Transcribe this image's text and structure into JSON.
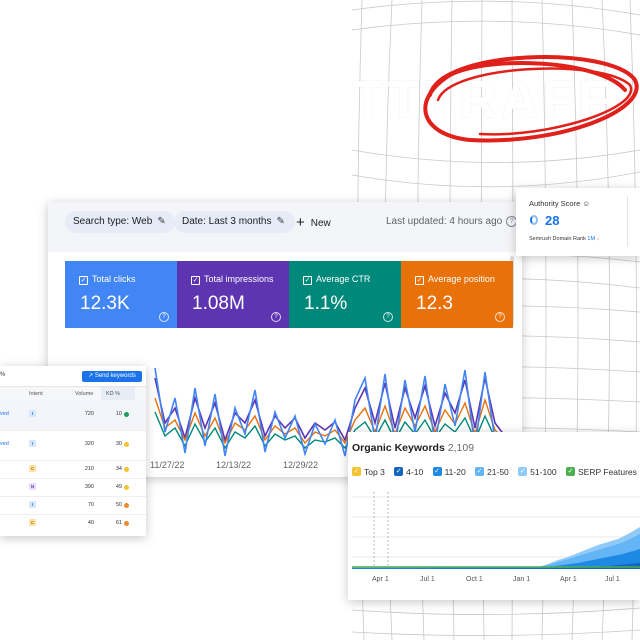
{
  "background": {
    "hero_word": "TTTRAFFIC"
  },
  "search_console": {
    "filters": {
      "search_type": "Search type: Web",
      "date": "Date: Last 3 months",
      "new_label": "New"
    },
    "last_updated": "Last updated: 4 hours ago",
    "metrics": [
      {
        "label": "Total clicks",
        "value": "12.3K",
        "color": "#4285f4"
      },
      {
        "label": "Total impressions",
        "value": "1.08M",
        "color": "#5e35b1"
      },
      {
        "label": "Average CTR",
        "value": "1.1%",
        "color": "#00897b"
      },
      {
        "label": "Average position",
        "value": "12.3",
        "color": "#e8710a"
      }
    ],
    "x_labels": [
      "11/27/22",
      "12/13/22",
      "12/29/22"
    ]
  },
  "keyword_table": {
    "percent_text": "%",
    "send_button": "Send keywords",
    "columns": {
      "intent": "Intent",
      "volume": "Volume",
      "kd": "KD %"
    },
    "rows": [
      {
        "keyword": "ved",
        "intent": "I",
        "volume": "720",
        "kd": "10",
        "kd_color": "#1b9e5a"
      },
      {
        "keyword": "ved",
        "intent": "I",
        "volume": "320",
        "kd": "30",
        "kd_color": "#f4c430"
      },
      {
        "keyword": "",
        "intent": "C",
        "volume": "210",
        "kd": "34",
        "kd_color": "#f4c430"
      },
      {
        "keyword": "",
        "intent": "N",
        "volume": "390",
        "kd": "49",
        "kd_color": "#f4c430"
      },
      {
        "keyword": "",
        "intent": "I",
        "volume": "70",
        "kd": "50",
        "kd_color": "#ee8b2e"
      },
      {
        "keyword": "",
        "intent": "C",
        "volume": "40",
        "kd": "61",
        "kd_color": "#ee8b2e"
      }
    ]
  },
  "authority": {
    "title": "Authority Score",
    "value": "28",
    "sub_label": "Semrush Domain Rank",
    "rank": "1M"
  },
  "organic_keywords": {
    "title": "Organic Keywords",
    "count": "2,109",
    "legend": [
      {
        "label": "Top 3",
        "color": "#f4c430"
      },
      {
        "label": "4-10",
        "color": "#1565c0"
      },
      {
        "label": "11-20",
        "color": "#1e88e5"
      },
      {
        "label": "21-50",
        "color": "#64b5f6"
      },
      {
        "label": "51-100",
        "color": "#90caf9"
      },
      {
        "label": "SERP Features",
        "color": "#4caf50"
      }
    ],
    "x_labels": [
      "Apr 1",
      "Jul 1",
      "Oct 1",
      "Jan 1",
      "Apr 1",
      "Jul 1"
    ]
  }
}
